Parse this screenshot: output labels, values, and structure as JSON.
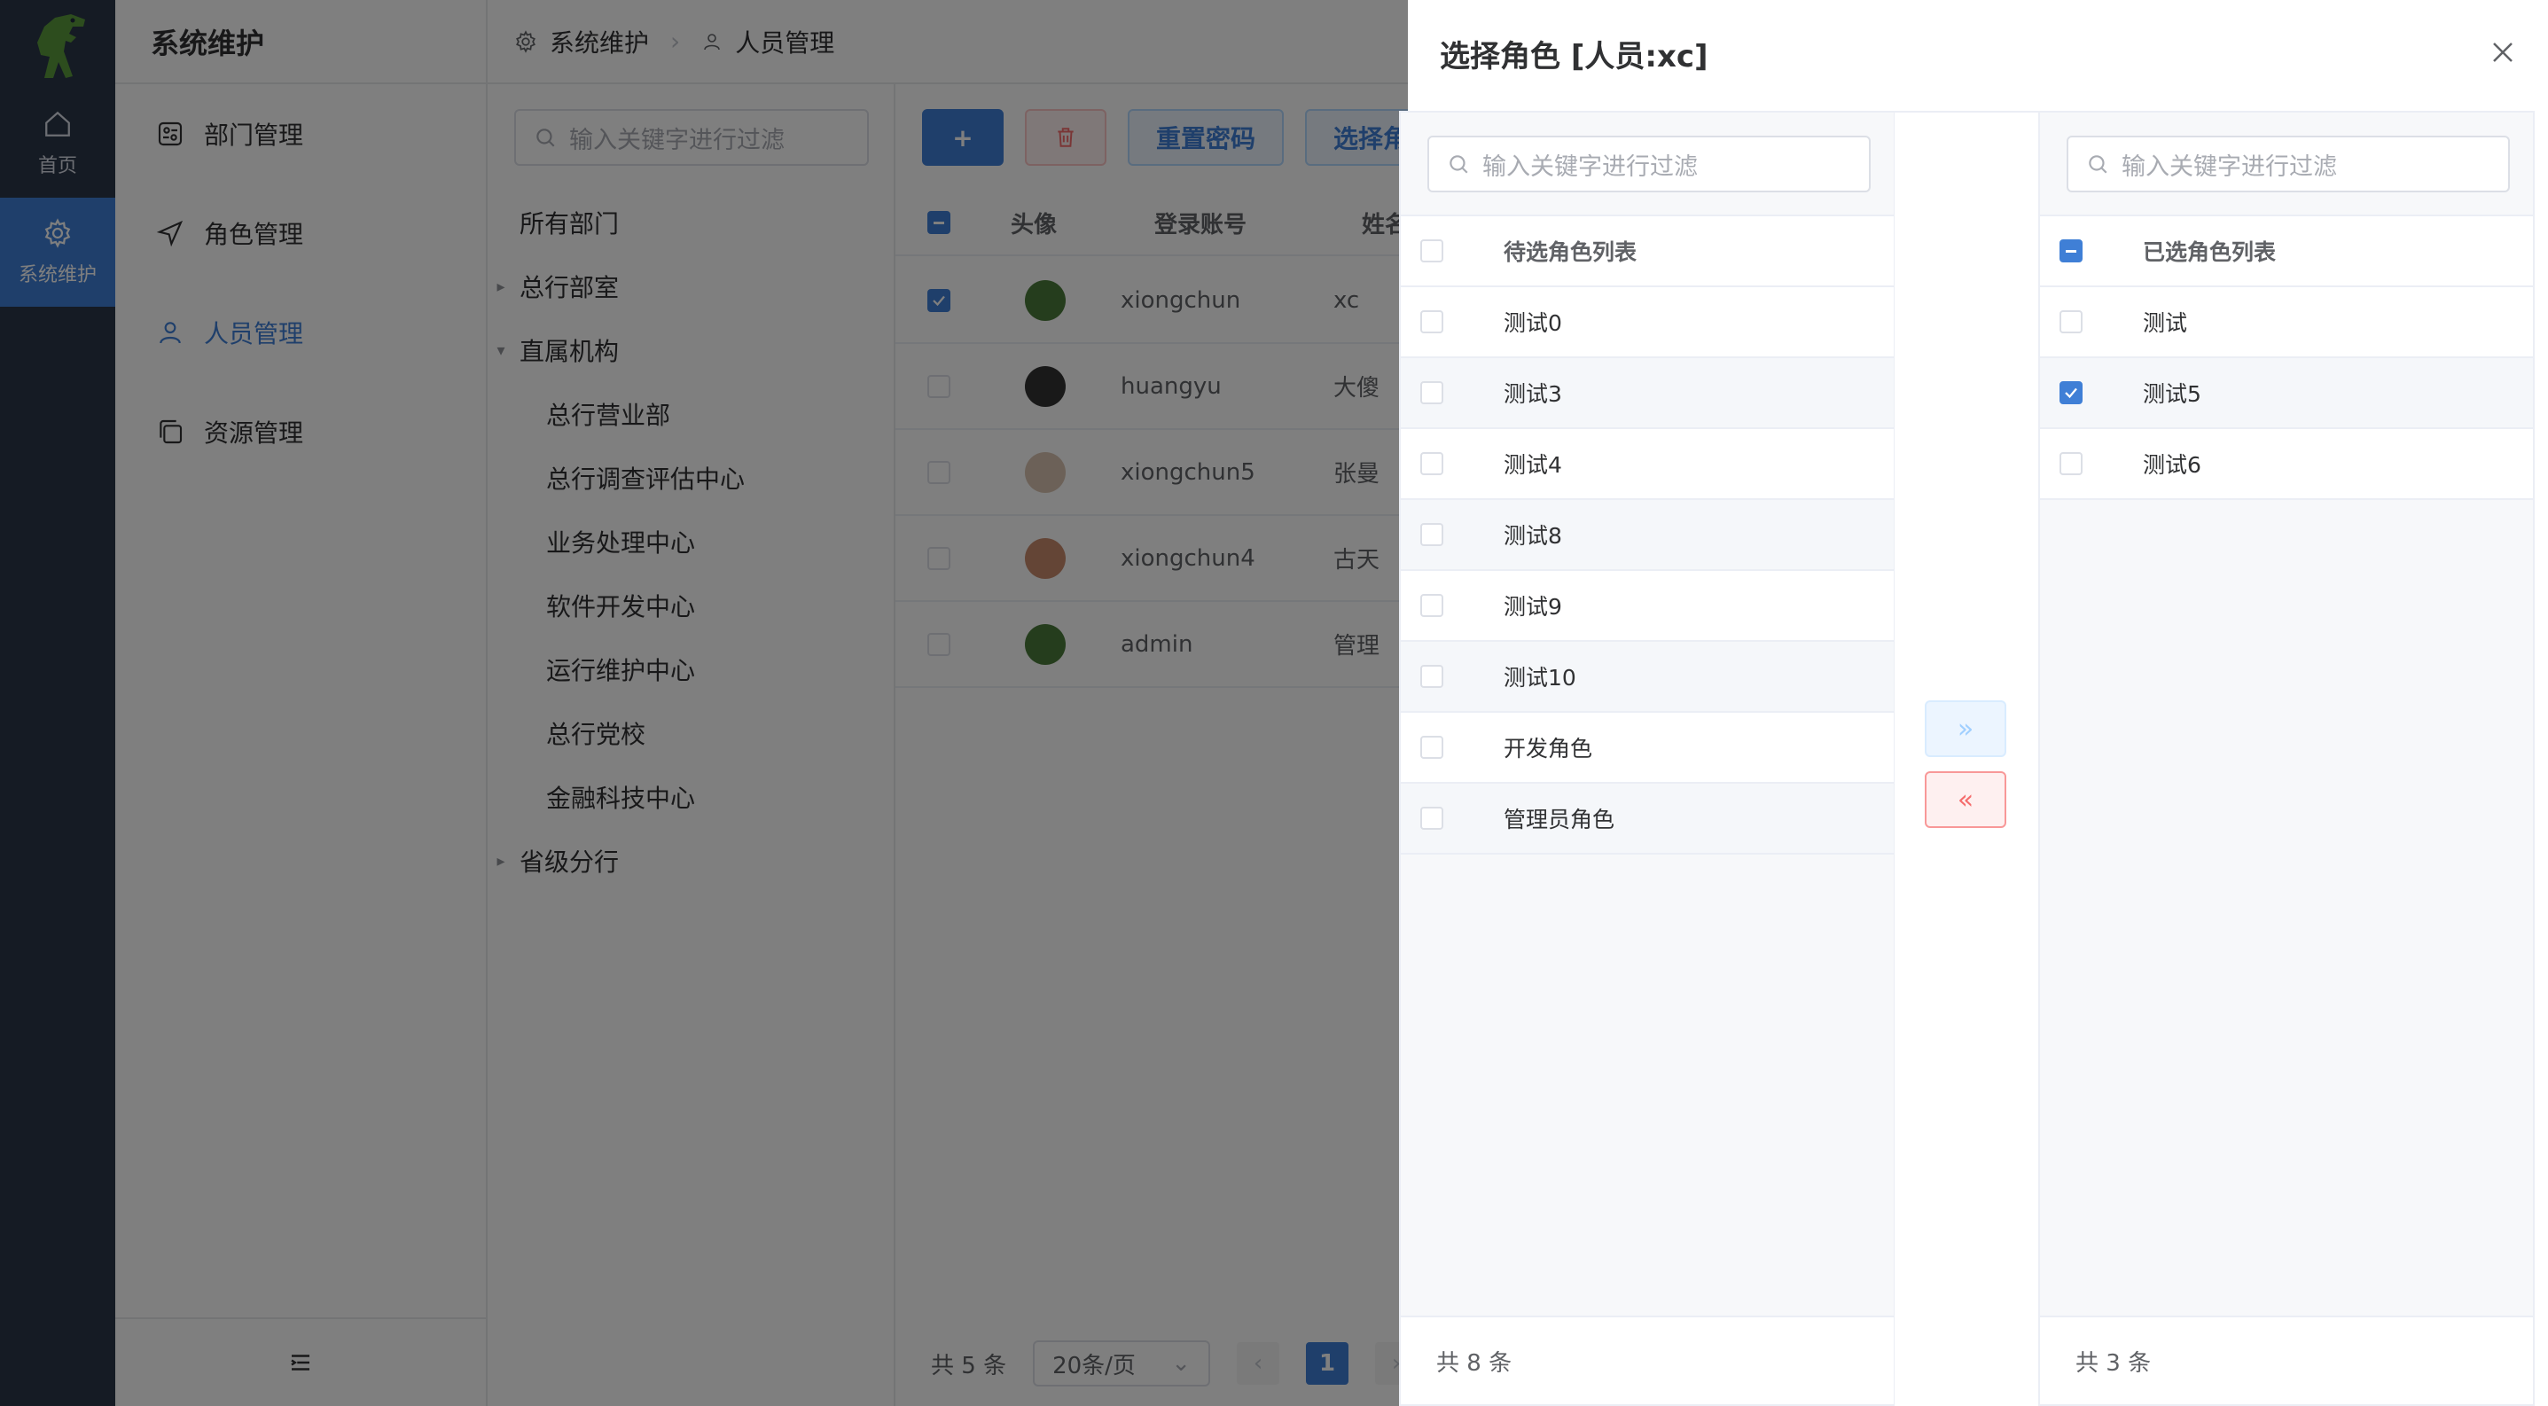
{
  "rail": {
    "home_label": "首页",
    "sys_label": "系统维护"
  },
  "menu": {
    "title": "系统维护",
    "items": [
      {
        "label": "部门管理",
        "icon": "department-icon"
      },
      {
        "label": "角色管理",
        "icon": "send-icon"
      },
      {
        "label": "人员管理",
        "icon": "user-icon"
      },
      {
        "label": "资源管理",
        "icon": "copy-icon"
      }
    ]
  },
  "breadcrumb": {
    "root": "系统维护",
    "current": "人员管理"
  },
  "tree": {
    "placeholder": "输入关键字进行过滤",
    "nodes": [
      {
        "label": "所有部门",
        "level": 0,
        "caret": ""
      },
      {
        "label": "总行部室",
        "level": 0,
        "caret": "right"
      },
      {
        "label": "直属机构",
        "level": 0,
        "caret": "down"
      },
      {
        "label": "总行营业部",
        "level": 1,
        "caret": ""
      },
      {
        "label": "总行调查评估中心",
        "level": 1,
        "caret": ""
      },
      {
        "label": "业务处理中心",
        "level": 1,
        "caret": ""
      },
      {
        "label": "软件开发中心",
        "level": 1,
        "caret": ""
      },
      {
        "label": "运行维护中心",
        "level": 1,
        "caret": ""
      },
      {
        "label": "总行党校",
        "level": 1,
        "caret": ""
      },
      {
        "label": "金融科技中心",
        "level": 1,
        "caret": ""
      },
      {
        "label": "省级分行",
        "level": 0,
        "caret": "right"
      }
    ]
  },
  "toolbar": {
    "add_label": "+",
    "reset_label": "重置密码",
    "select_role_label": "选择角"
  },
  "table": {
    "headers": {
      "avatar": "头像",
      "account": "登录账号",
      "name": "姓名"
    },
    "rows": [
      {
        "account": "xiongchun",
        "name": "xc",
        "checked": true,
        "avatar_color": "#4a7a3a"
      },
      {
        "account": "huangyu",
        "name": "大傻",
        "checked": false,
        "avatar_color": "#333333"
      },
      {
        "account": "xiongchun5",
        "name": "张曼",
        "checked": false,
        "avatar_color": "#d8c3b0"
      },
      {
        "account": "xiongchun4",
        "name": "古天",
        "checked": false,
        "avatar_color": "#c98b6d"
      },
      {
        "account": "admin",
        "name": "管理",
        "checked": false,
        "avatar_color": "#4a7a3a"
      }
    ],
    "total": "共 5 条",
    "page_size": "20条/页",
    "current_page": "1"
  },
  "drawer": {
    "title": "选择角色 [人员:xc]",
    "left": {
      "placeholder": "输入关键字进行过滤",
      "header": "待选角色列表",
      "items": [
        "测试0",
        "测试3",
        "测试4",
        "测试8",
        "测试9",
        "测试10",
        "开发角色",
        "管理员角色"
      ],
      "footer": "共 8 条"
    },
    "right": {
      "placeholder": "输入关键字进行过滤",
      "header": "已选角色列表",
      "items": [
        {
          "label": "测试",
          "checked": false
        },
        {
          "label": "测试5",
          "checked": true
        },
        {
          "label": "测试6",
          "checked": false
        }
      ],
      "footer": "共 3 条"
    },
    "to_right": "»",
    "to_left": "«"
  },
  "colors": {
    "primary": "#3f7fd6",
    "danger": "#f56c6c",
    "rail": "#2b3648"
  }
}
